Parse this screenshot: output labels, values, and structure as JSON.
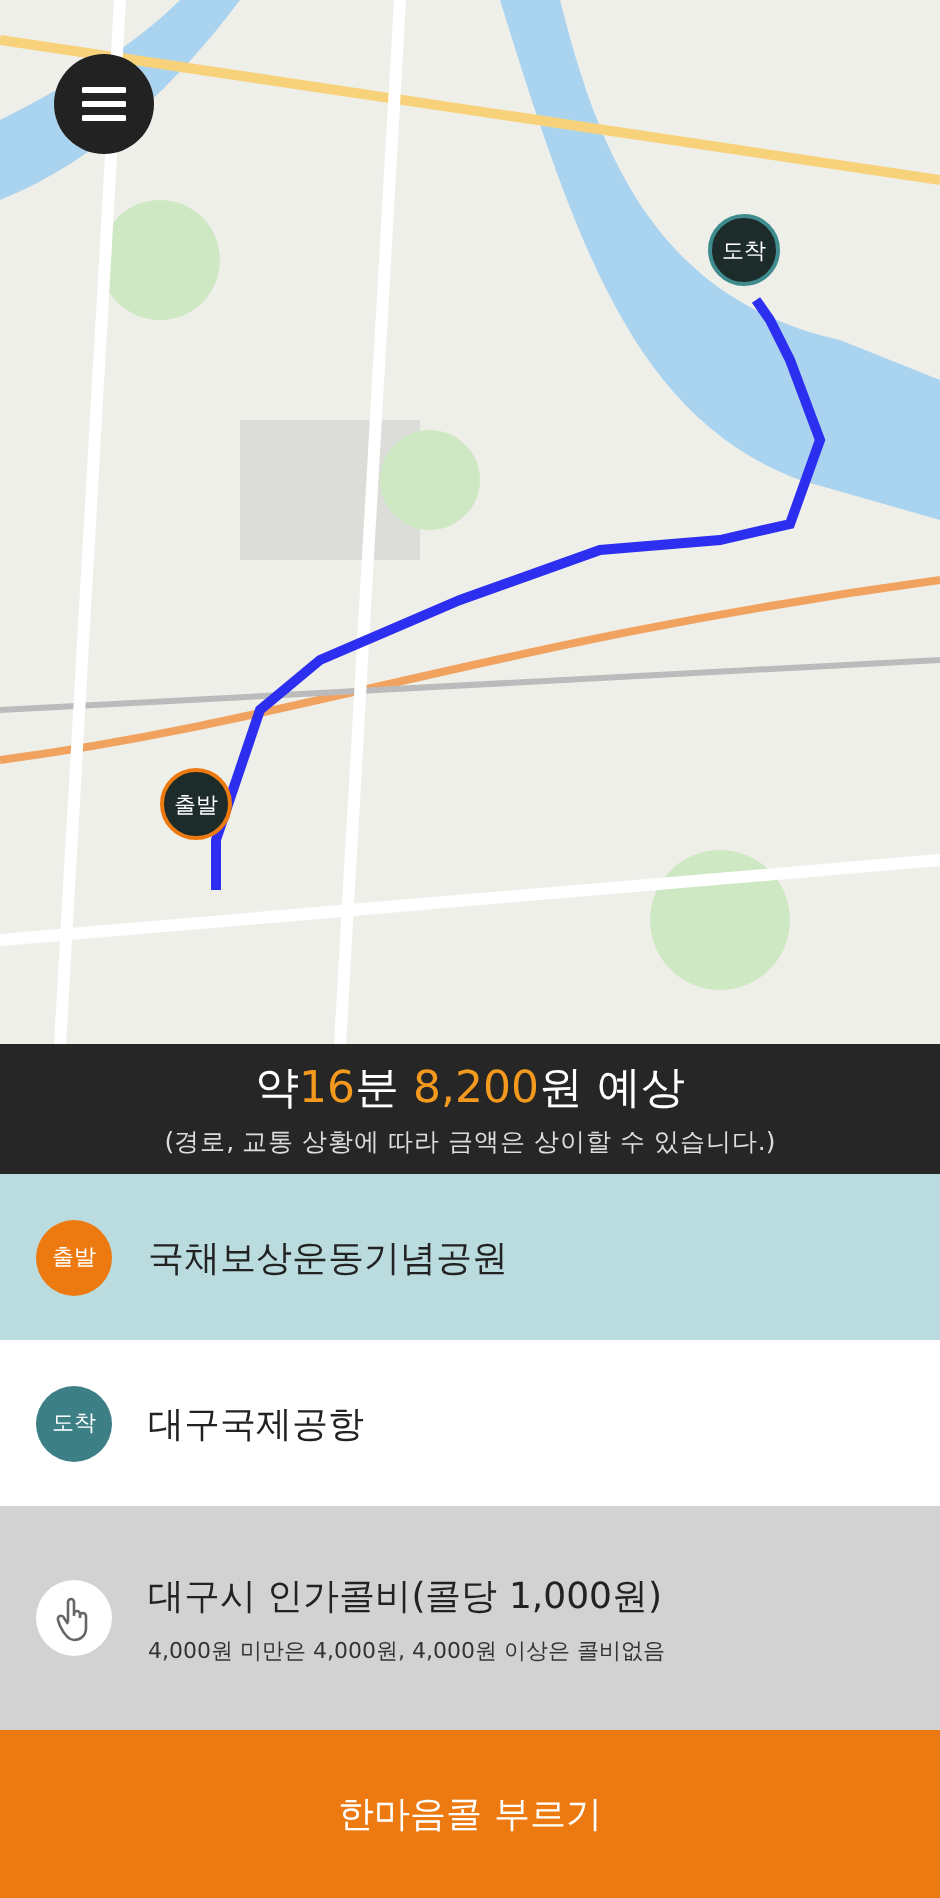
{
  "map": {
    "kind": "picture",
    "pins": [
      {
        "kind": "end",
        "label": "도착"
      },
      {
        "kind": "start",
        "label": "출발"
      }
    ]
  },
  "estimate": {
    "parts": [
      {
        "text": "약",
        "highlight": false
      },
      {
        "text": "16",
        "highlight": true
      },
      {
        "text": "분 ",
        "highlight": false
      },
      {
        "text": "8,200",
        "highlight": true
      },
      {
        "text": "원 예상",
        "highlight": false
      }
    ],
    "note": "(경로, 교통 상황에 따라 금액은 상이할 수 있습니다.)"
  },
  "places": [
    {
      "kind": "start",
      "badge": "출발",
      "name": "국채보상운동기념공원"
    },
    {
      "kind": "end",
      "badge": "도착",
      "name": "대구국제공항"
    }
  ],
  "fare": {
    "title": "대구시 인가콜비(콜당 1,000원)",
    "detail": "4,000원 미만은 4,000원, 4,000원 이상은 콜비없음"
  },
  "call_button": "한마음콜 부르기"
}
